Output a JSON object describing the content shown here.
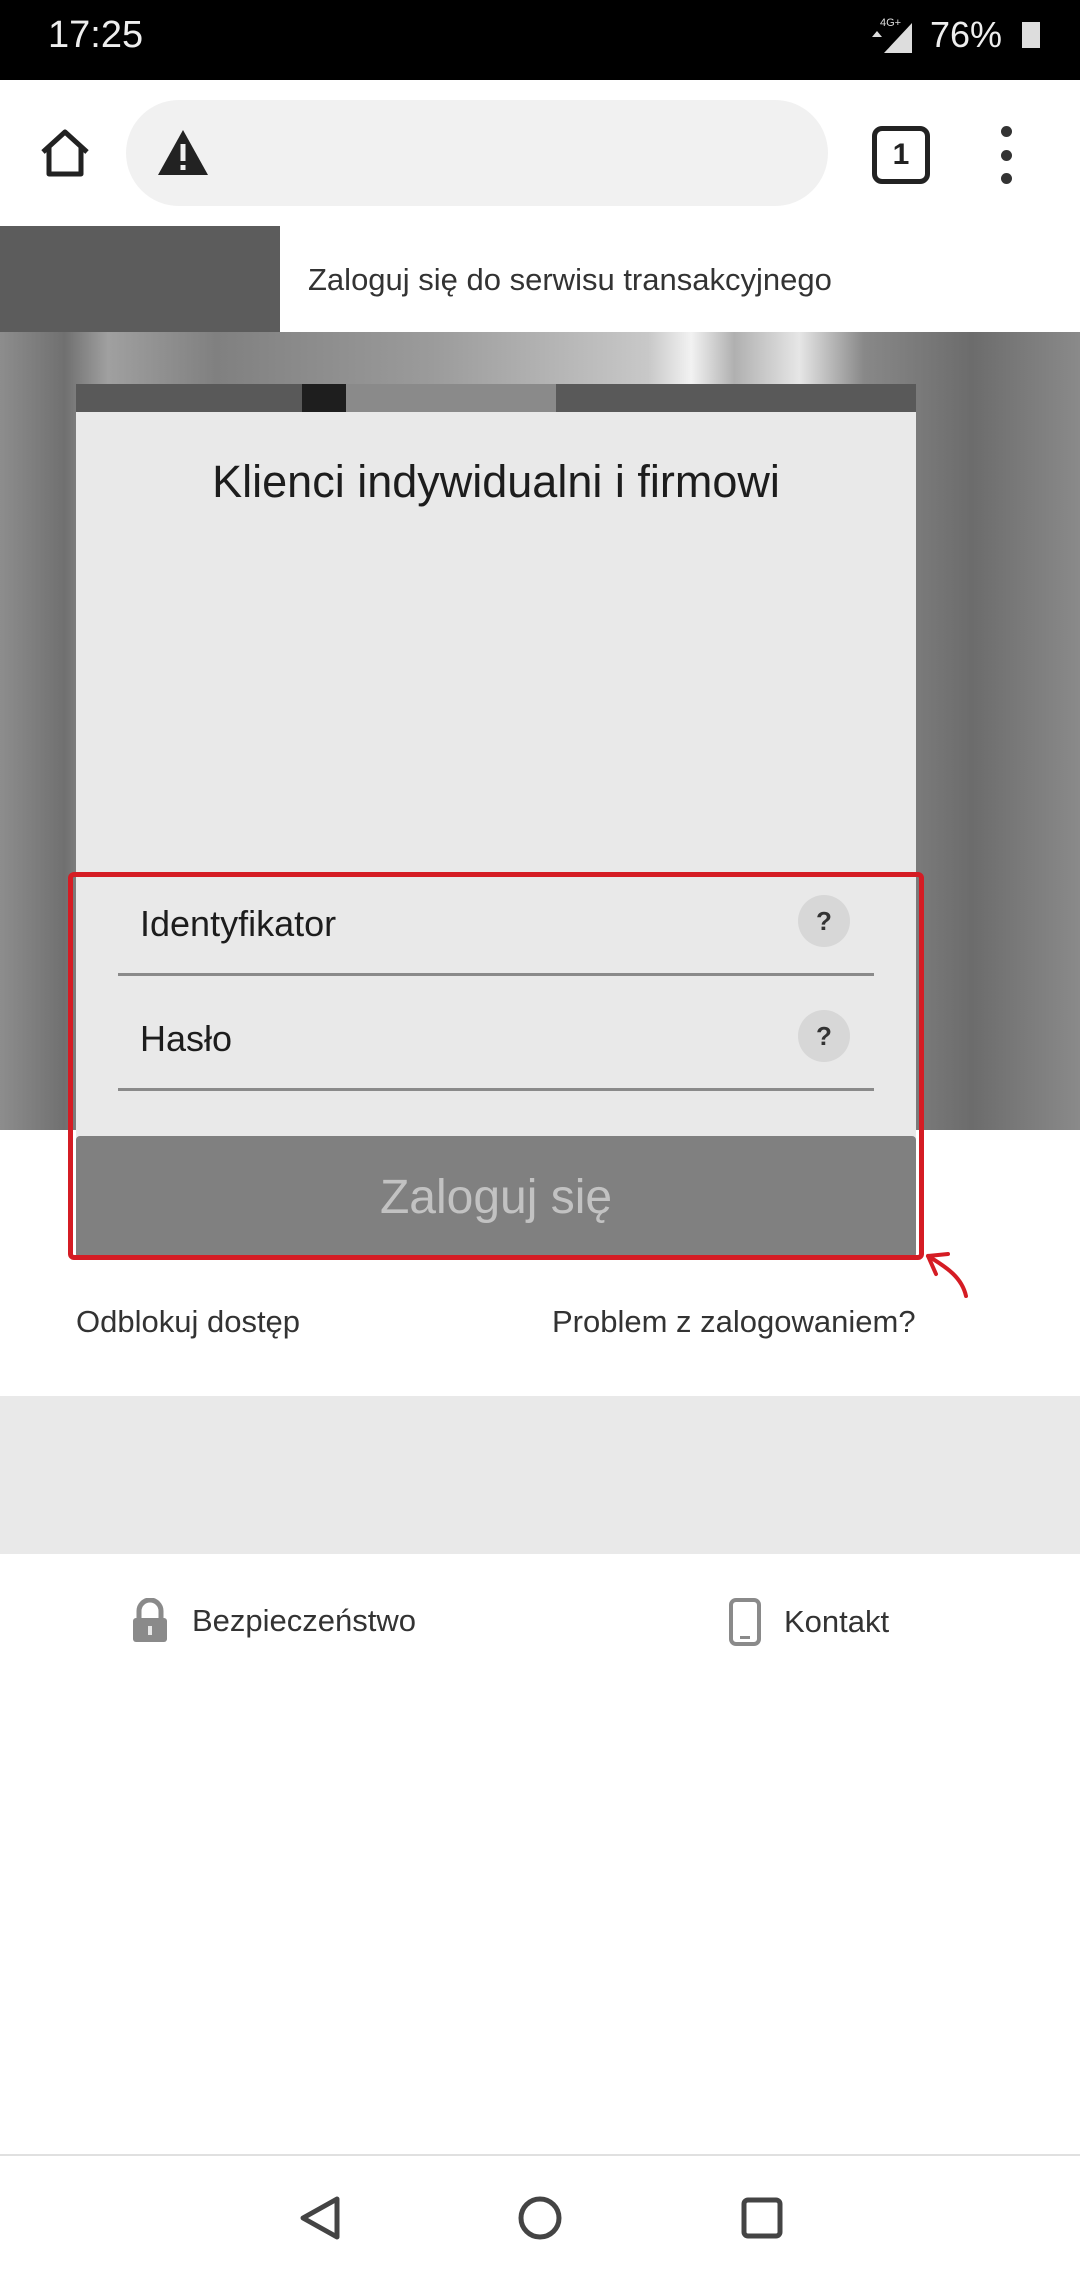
{
  "status_bar": {
    "time": "17:25",
    "network": "4G+",
    "battery": "76%"
  },
  "browser": {
    "tab_count": "1",
    "icons": [
      "home-icon",
      "warning-icon",
      "tabs-icon",
      "more-vert-icon"
    ]
  },
  "site_header": {
    "title": "Zaloguj się do serwisu transakcyjnego"
  },
  "login_card": {
    "title": "Klienci indywidualni i firmowi",
    "identifier_label": "Identyfikator",
    "password_label": "Hasło",
    "help_symbol": "?",
    "submit_label": "Zaloguj się"
  },
  "links": {
    "unblock": "Odblokuj dostęp",
    "problem": "Problem z zalogowaniem?"
  },
  "footer": {
    "security": "Bezpieczeństwo",
    "contact": "Kontakt"
  },
  "colors": {
    "highlight": "#d51c24",
    "button_bg": "#808080",
    "card_bg": "#e9e9e9"
  }
}
